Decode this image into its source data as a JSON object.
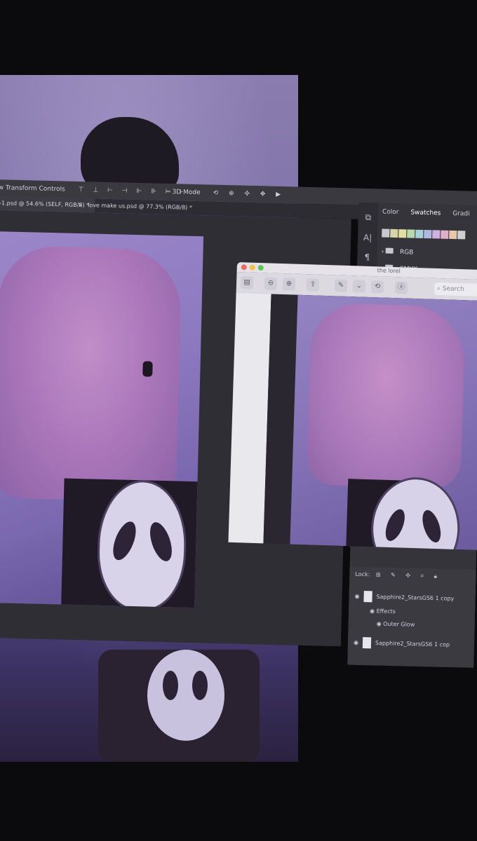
{
  "options_bar": {
    "label": "w Transform Controls",
    "mode_label": "3D Mode"
  },
  "tabs": [
    {
      "label": "-1.psd @ 54.6% (SELF, RGB/8) *"
    },
    {
      "label": "love make us.psd @ 77.3% (RGB/8) *"
    }
  ],
  "panels": {
    "tabs": [
      "Color",
      "Swatches",
      "Gradi"
    ],
    "swatch_colors": [
      "#c9c8cc",
      "#d8d4a8",
      "#e0e0a0",
      "#b8d8b0",
      "#a8d0d8",
      "#b0b8e0",
      "#d0b0e0",
      "#e0b0c8",
      "#e8c8a8",
      "#d0d0d0"
    ],
    "folders": [
      {
        "label": "RGB"
      },
      {
        "label": "CMYK"
      }
    ]
  },
  "layers": {
    "rows": [
      {
        "label": "Sapphire2_StarsGS6 1 copy"
      },
      {
        "label": "Effects"
      },
      {
        "label": "Outer Glow"
      },
      {
        "label": "Sapphire2_StarsGS6 1 cop"
      }
    ],
    "lock_label": "Lock:"
  },
  "preview": {
    "window_title": "the lorel",
    "search_placeholder": "Search",
    "traffic_lights": [
      "#ed6a5e",
      "#f5bf4f",
      "#61c554"
    ]
  }
}
